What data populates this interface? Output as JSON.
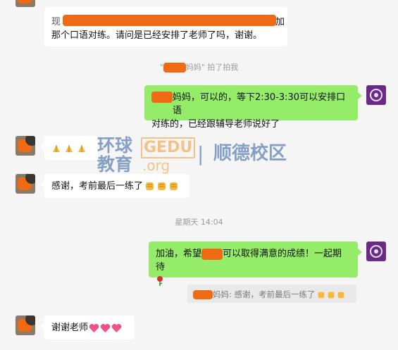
{
  "messages": {
    "m1": {
      "line1_end": "加",
      "line2": "那个口语对练。请问是已经安排了老师了吗，谢谢。"
    },
    "pat": {
      "open_quote": "\"",
      "suffix": "妈妈\" 拍了拍我"
    },
    "m2": {
      "line1": "妈妈，可以的，等下2:30-3:30可以安排口语",
      "line2": "对练的，已经跟辅导老师说好了"
    },
    "m4": {
      "text": "感谢，考前最后一练了"
    },
    "timestamp": "星期天 14:04",
    "m5": {
      "line1_a": "加油，希望",
      "line1_b": "可以取得满意的成绩！一起期待"
    },
    "quote": {
      "text": "妈妈: 感谢，考前最后一练了"
    },
    "m6": {
      "text": "谢谢老师"
    }
  },
  "watermark": {
    "cn_top": "环球",
    "cn_bottom": "教育",
    "gedu": "GEDU",
    "org": ".org",
    "divider": "|",
    "campus": "顺德校区"
  },
  "colors": {
    "background": "#f5f5f5",
    "bubble_self": "#95ec69",
    "bubble_other": "#ffffff",
    "redaction": "#f06a14",
    "watermark_blue": "#2c5aa0",
    "watermark_orange": "#f39a2a"
  },
  "icons": [
    "pray-emoji",
    "fist-emoji",
    "heart-emoji",
    "rose-emoji"
  ]
}
